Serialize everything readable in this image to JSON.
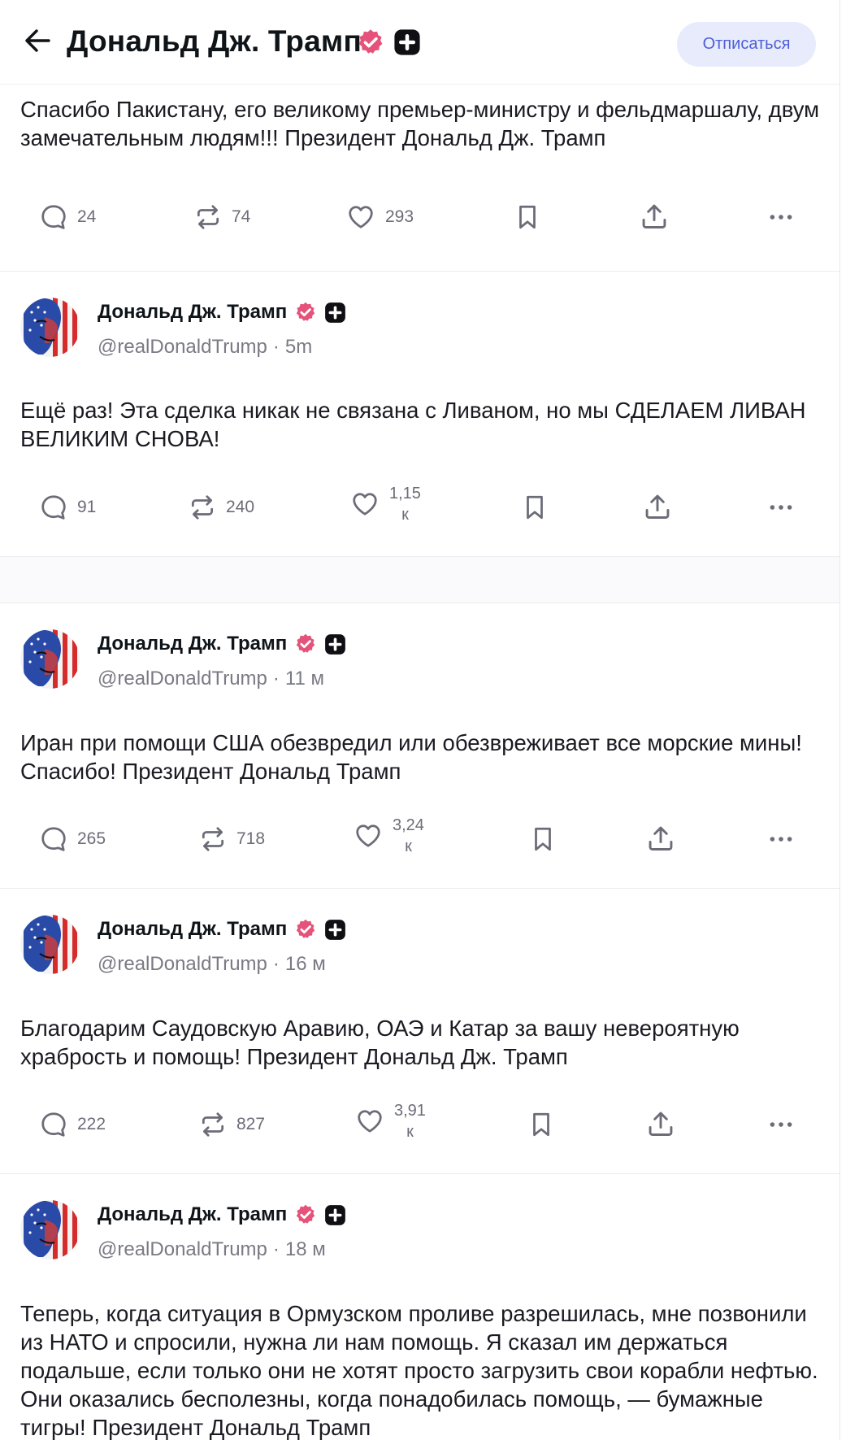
{
  "header": {
    "title": "Дональд Дж. Трамп",
    "unsubscribe_label": "Отписаться"
  },
  "colors": {
    "verified_badge": "#e5527a",
    "button_bg": "#e8ebfb",
    "button_text": "#4b5fd6",
    "muted": "#7a7a85"
  },
  "posts": [
    {
      "text": "Спасибо Пакистану, его великому премьер-министру и фельдмаршалу, двум замечательным людям!!! Президент Дональд Дж. Трамп",
      "replies": "24",
      "reposts": "74",
      "likes": "293",
      "likes_unit": ""
    },
    {
      "author": "Дональд Дж. Трамп",
      "handle": "@realDonaldTrump",
      "time": "5m",
      "text": "Ещё раз! Эта сделка никак не связана с Ливаном, но мы СДЕЛАЕМ ЛИВАН ВЕЛИКИМ СНОВА!",
      "replies": "91",
      "reposts": "240",
      "likes": "1,15",
      "likes_unit": "к"
    },
    {
      "author": "Дональд Дж. Трамп",
      "handle": "@realDonaldTrump",
      "time": "11 м",
      "text": "Иран при помощи США обезвредил или обезвреживает все морские мины! Спасибо! Президент Дональд Трамп",
      "replies": "265",
      "reposts": "718",
      "likes": "3,24",
      "likes_unit": "к"
    },
    {
      "author": "Дональд Дж. Трамп",
      "handle": "@realDonaldTrump",
      "time": "16 м",
      "text": "Благодарим Саудовскую Аравию, ОАЭ и Катар за вашу невероятную храбрость и помощь! Президент Дональд Дж. Трамп",
      "replies": "222",
      "reposts": "827",
      "likes": "3,91",
      "likes_unit": "к"
    },
    {
      "author": "Дональд Дж. Трамп",
      "handle": "@realDonaldTrump",
      "time": "18 м",
      "text": "Теперь, когда ситуация в Ормузском проливе разрешилась, мне позвонили из НАТО и спросили, нужна ли нам помощь. Я сказал им держаться подальше, если только они не хотят просто загрузить свои корабли нефтью. Они оказались бесполезны, когда понадобилась помощь, — бумажные тигры! Президент Дональд Трамп"
    }
  ],
  "icons": [
    "back-arrow-icon",
    "verified-badge-icon",
    "plus-badge-icon",
    "reply-icon",
    "repost-icon",
    "like-icon",
    "bookmark-icon",
    "share-icon",
    "more-icon"
  ]
}
